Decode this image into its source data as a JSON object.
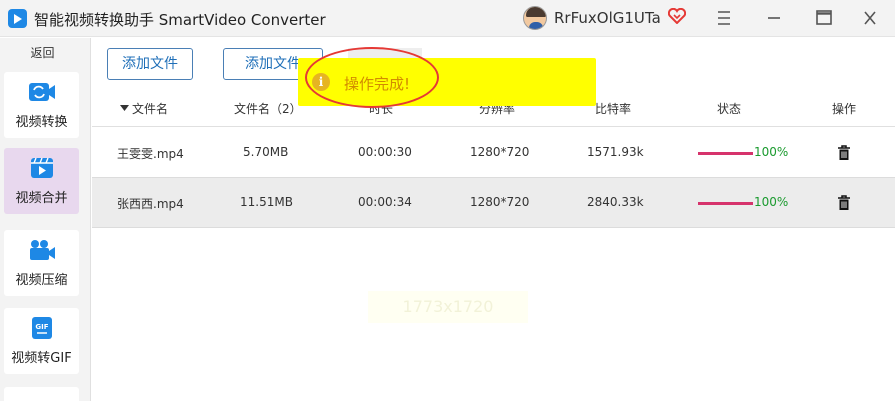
{
  "window": {
    "title": "智能视频转换助手 SmartVideo Converter",
    "username": "RrFuxOlG1UTa"
  },
  "sidebar": {
    "back_label": "返回",
    "items": [
      {
        "label": "视频转换",
        "icon": "video-convert-icon",
        "active": false
      },
      {
        "label": "视频合并",
        "icon": "video-merge-icon",
        "active": true
      },
      {
        "label": "视频压缩",
        "icon": "video-compress-icon",
        "active": false
      },
      {
        "label": "视频转GIF",
        "icon": "gif-icon",
        "active": false
      }
    ]
  },
  "toolbar": {
    "add_file_label": "添加文件",
    "add_folder_label": "添加文件"
  },
  "table": {
    "headers": {
      "name": "文件名",
      "size": "文件名（2）",
      "duration": "时长",
      "resolution": "分辨率",
      "bitrate": "比特率",
      "status": "状态",
      "action": "操作"
    },
    "rows": [
      {
        "name": "王雯雯.mp4",
        "size": "5.70MB",
        "duration": "00:00:30",
        "resolution": "1280*720",
        "bitrate": "1571.93k",
        "progress": 1.0,
        "progress_text": "100%",
        "selected": false
      },
      {
        "name": "张西西.mp4",
        "size": "11.51MB",
        "duration": "00:00:34",
        "resolution": "1280*720",
        "bitrate": "2840.33k",
        "progress": 1.0,
        "progress_text": "100%",
        "selected": true
      }
    ]
  },
  "toast": {
    "message": "操作完成!",
    "icon": "info-icon"
  },
  "watermark": {
    "text": "1773x1720"
  },
  "colors": {
    "accent": "#1f6fb8",
    "progress": "#d6336c",
    "status_ok": "#1a9a2e",
    "toast_bg": "#ffff00",
    "annotation": "#e53935"
  }
}
